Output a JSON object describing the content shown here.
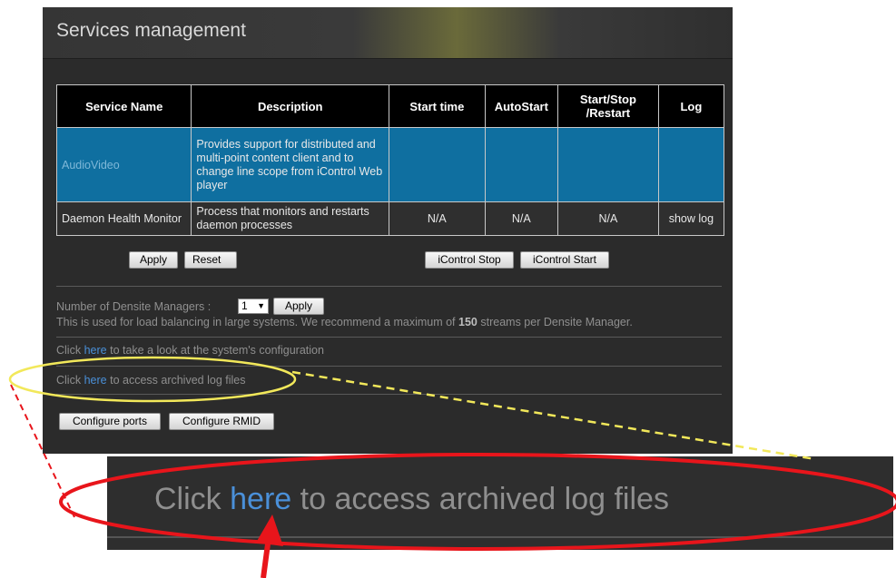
{
  "panel": {
    "title": "Services management"
  },
  "table": {
    "headers": [
      "Service Name",
      "Description",
      "Start time",
      "AutoStart",
      "Start/Stop /Restart",
      "Log"
    ],
    "rows": [
      {
        "name": "AudioVideo",
        "description": "Provides support for distributed and multi-point content client and to change line scope from iControl Web player",
        "start_time": "",
        "autostart": "",
        "start_stop": "",
        "log": ""
      },
      {
        "name": "Daemon Health Monitor",
        "description": "Process that monitors and restarts daemon processes",
        "start_time": "N/A",
        "autostart": "N/A",
        "start_stop": "N/A",
        "log": "show log"
      }
    ]
  },
  "buttons": {
    "apply": "Apply",
    "reset": "Reset",
    "icontrol_stop": "iControl Stop",
    "icontrol_start": "iControl Start",
    "managers_apply": "Apply",
    "configure_ports": "Configure ports",
    "configure_rmid": "Configure RMID"
  },
  "managers": {
    "label": "Number of Densite Managers :",
    "selected": "1",
    "note_prefix": "This is used for load balancing in large systems. We recommend a maximum of",
    "note_max": "150",
    "note_suffix": "streams per Densite Manager."
  },
  "config_line": {
    "prefix": "Click",
    "link": "here",
    "suffix": "to take a look at the system's configuration"
  },
  "archive_line": {
    "prefix": "Click",
    "link": "here",
    "suffix": "to access archived log files"
  },
  "zoom": {
    "prefix": "Click",
    "link": "here",
    "suffix": "to access archived log files"
  },
  "colors": {
    "highlight_yellow": "#f2e85a",
    "highlight_red": "#e8151b",
    "selected_row": "#0f6fa0",
    "link": "#4a90d9"
  }
}
